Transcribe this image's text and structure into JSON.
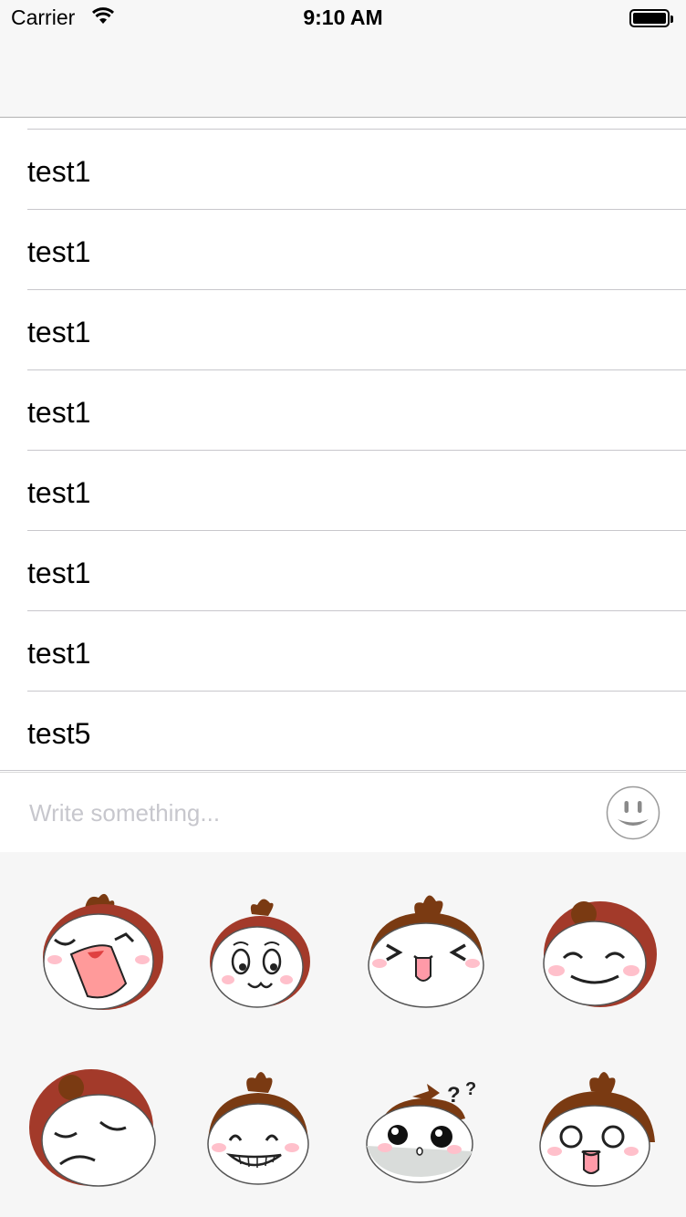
{
  "status_bar": {
    "carrier": "Carrier",
    "time": "9:10 AM"
  },
  "list": {
    "rows": [
      {
        "label": "test1"
      },
      {
        "label": "test1"
      },
      {
        "label": "test1"
      },
      {
        "label": "test1"
      },
      {
        "label": "test1"
      },
      {
        "label": "test1"
      },
      {
        "label": "test1"
      },
      {
        "label": "test5"
      }
    ]
  },
  "composer": {
    "placeholder": "Write something...",
    "value": ""
  },
  "emoji_panel": {
    "stickers": [
      {
        "name": "sticker-crying"
      },
      {
        "name": "sticker-smirk"
      },
      {
        "name": "sticker-tongue-squint"
      },
      {
        "name": "sticker-smile"
      },
      {
        "name": "sticker-sleepy"
      },
      {
        "name": "sticker-grin"
      },
      {
        "name": "sticker-confused"
      },
      {
        "name": "sticker-surprised-tongue"
      }
    ]
  },
  "colors": {
    "nav_background": "#f7f7f7",
    "separator": "#c8c7cc",
    "placeholder": "#c7c7cd",
    "panel_background": "#f6f6f6",
    "hair_brown": "#7a3a12",
    "hair_red": "#a33a2a",
    "cheek_pink": "#ffc0cb"
  }
}
